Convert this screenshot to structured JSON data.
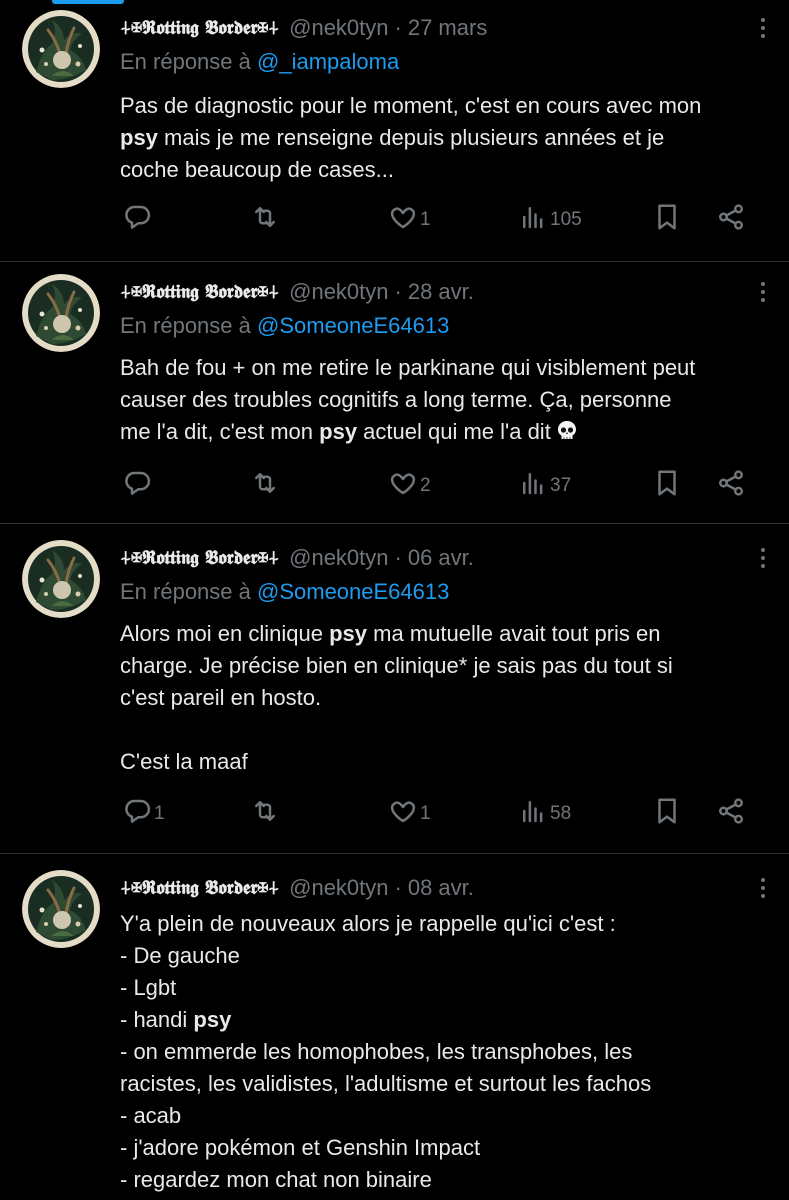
{
  "tweets": [
    {
      "name": "⍭✠𝕽𝖔𝖙𝖙𝖎𝖓𝖌 𝕭𝖔𝖗𝖉𝖊𝖗✠⍭",
      "handle": "@nek0tyn",
      "sep": "·",
      "date": "27 mars",
      "reply_prefix": "En réponse à",
      "reply_to": "@_iampaloma",
      "lines": [
        [
          "Pas de diagnostic pour le moment, c'est en cours avec mon"
        ],
        [
          "",
          "psy",
          " mais je me renseigne depuis plusieurs années et je"
        ],
        [
          "coche beaucoup de cases..."
        ]
      ],
      "stats": {
        "replies": "",
        "retweets": "",
        "likes": "1",
        "views": "105"
      }
    },
    {
      "name": "⍭✠𝕽𝖔𝖙𝖙𝖎𝖓𝖌 𝕭𝖔𝖗𝖉𝖊𝖗✠⍭",
      "handle": "@nek0tyn",
      "sep": "·",
      "date": "28 avr.",
      "reply_prefix": "En réponse à",
      "reply_to": "@SomeoneE64613",
      "lines": [
        [
          "Bah de fou + on me retire le parkinane qui visiblement peut"
        ],
        [
          "causer des troubles cognitifs a long terme. Ça, personne"
        ],
        [
          "me l'a dit, c'est mon ",
          "psy",
          " actuel qui me l'a dit"
        ]
      ],
      "emoji": "skull-emoji",
      "stats": {
        "replies": "",
        "retweets": "",
        "likes": "2",
        "views": "37"
      }
    },
    {
      "name": "⍭✠𝕽𝖔𝖙𝖙𝖎𝖓𝖌 𝕭𝖔𝖗𝖉𝖊𝖗✠⍭",
      "handle": "@nek0tyn",
      "sep": "·",
      "date": "06 avr.",
      "reply_prefix": "En réponse à",
      "reply_to": "@SomeoneE64613",
      "lines": [
        [
          "Alors moi en clinique ",
          "psy",
          " ma mutuelle avait tout pris en"
        ],
        [
          "charge. Je précise bien en clinique* je sais pas du tout si"
        ],
        [
          "c'est pareil en hosto."
        ],
        [
          ""
        ],
        [
          "C'est la maaf"
        ]
      ],
      "stats": {
        "replies": "1",
        "retweets": "",
        "likes": "1",
        "views": "58"
      }
    },
    {
      "name": "⍭✠𝕽𝖔𝖙𝖙𝖎𝖓𝖌 𝕭𝖔𝖗𝖉𝖊𝖗✠⍭",
      "handle": "@nek0tyn",
      "sep": "·",
      "date": "08 avr.",
      "lines": [
        [
          "Y'a plein de nouveaux alors je rappelle qu'ici c'est :"
        ],
        [
          "- De gauche"
        ],
        [
          "- Lgbt"
        ],
        [
          "- handi ",
          "psy"
        ],
        [
          "- on emmerde les homophobes, les transphobes, les"
        ],
        [
          "racistes, les validistes, l'adultisme et surtout les fachos"
        ],
        [
          "- acab"
        ],
        [
          "- j'adore pokémon et Genshin Impact"
        ],
        [
          "- regardez mon chat non binaire"
        ]
      ]
    }
  ]
}
